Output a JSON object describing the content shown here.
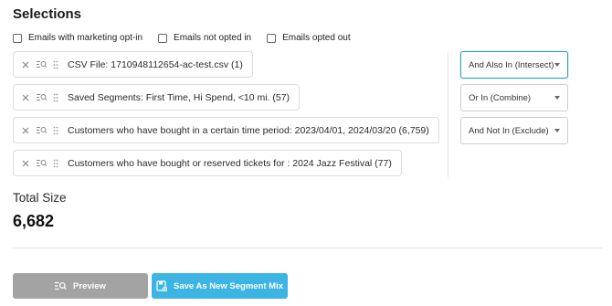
{
  "section": {
    "title": "Selections"
  },
  "filters": [
    {
      "label": "Emails with marketing opt-in",
      "checked": false
    },
    {
      "label": "Emails not opted in",
      "checked": false
    },
    {
      "label": "Emails opted out",
      "checked": false
    }
  ],
  "segments": [
    {
      "label": "CSV File: 1710948112654-ac-test.csv (1)"
    },
    {
      "label": "Saved Segments: First Time, Hi Spend, <10 mi. (57)"
    },
    {
      "label": "Customers who have bought in a certain time period: 2023/04/01, 2024/03/20 (6,759)"
    },
    {
      "label": "Customers who have bought or reserved tickets for : 2024 Jazz Festival (77)"
    }
  ],
  "operators": [
    {
      "value": "And Also In (Intersect)",
      "active": true
    },
    {
      "value": "Or In (Combine)",
      "active": false
    },
    {
      "value": "And Not In (Exclude)",
      "active": false
    }
  ],
  "total": {
    "label": "Total Size",
    "value": "6,682"
  },
  "actions": {
    "preview_label": "Preview",
    "save_label": "Save As New Segment Mix"
  },
  "colors": {
    "accent": "#3cb5e4",
    "active_border": "#2f9bd1",
    "disabled_button": "#a3a3a3"
  },
  "icons": {
    "remove": "close-icon",
    "view": "search-list-icon",
    "reorder": "drag-handle-icon",
    "dropdown": "chevron-down-icon",
    "save": "save-icon"
  }
}
